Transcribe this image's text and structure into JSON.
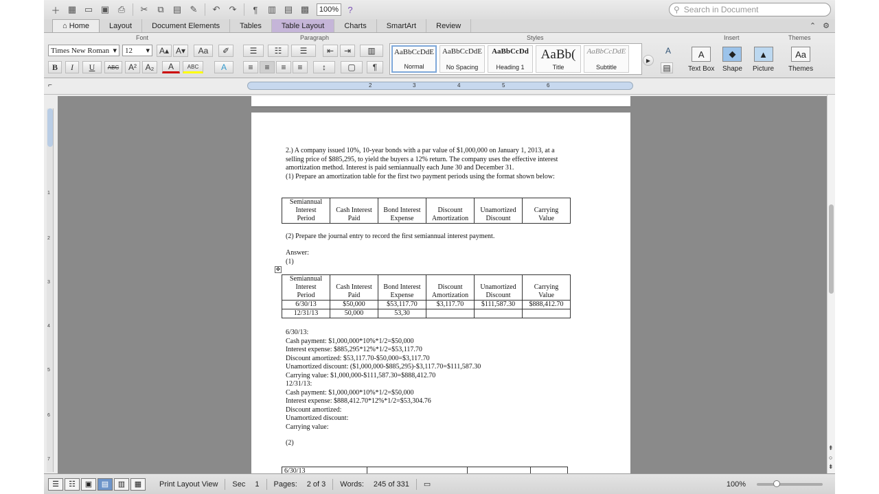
{
  "toolbar": {
    "zoom": "100%",
    "search_placeholder": "Search in Document"
  },
  "tabs": [
    "Home",
    "Layout",
    "Document Elements",
    "Tables",
    "Table Layout",
    "Charts",
    "SmartArt",
    "Review"
  ],
  "ribbon": {
    "font_group": "Font",
    "paragraph_group": "Paragraph",
    "styles_group": "Styles",
    "insert_group": "Insert",
    "themes_group": "Themes",
    "font_name": "Times New Roman",
    "font_size": "12",
    "styles": [
      {
        "sample": "AaBbCcDdE",
        "label": "Normal"
      },
      {
        "sample": "AaBbCcDdE",
        "label": "No Spacing"
      },
      {
        "sample": "AaBbCcDd",
        "label": "Heading 1"
      },
      {
        "sample": "AaBb(",
        "label": "Title"
      },
      {
        "sample": "AaBbCcDdE",
        "label": "Subtitle"
      }
    ],
    "insert": [
      "Text Box",
      "Shape",
      "Picture"
    ],
    "themes": "Themes"
  },
  "ruler": [
    "2",
    "3",
    "4",
    "5",
    "6"
  ],
  "vruler": [
    "1",
    "2",
    "3",
    "4",
    "5",
    "6",
    "7"
  ],
  "document": {
    "intro": [
      "2.) A company issued 10%, 10-year bonds with a par value of $1,000,000 on January 1, 2013, at a",
      "selling price of $885,295, to yield the buyers a 12% return. The company uses the effective interest",
      "amortization method. Interest is paid semiannually each June 30 and December 31.",
      "(1) Prepare an amortization table for the first two payment periods using the format shown below:"
    ],
    "headers": [
      [
        "Semiannual",
        "Interest",
        "Period"
      ],
      [
        "Cash Interest",
        "Paid"
      ],
      [
        "Bond Interest",
        "Expense"
      ],
      [
        "Discount",
        "Amortization"
      ],
      [
        "Unamortized",
        "Discount"
      ],
      [
        "Carrying",
        "Value"
      ]
    ],
    "part2": "(2) Prepare the journal entry to record the first semiannual interest payment.",
    "answer": "Answer:",
    "part1_label": "(1)",
    "rows": [
      [
        "6/30/13",
        "$50,000",
        "$53,117.70",
        "$3,117.70",
        "$111,587.30",
        "$888,412.70"
      ],
      [
        "12/31/13",
        "50,000",
        "53,30",
        "",
        "",
        ""
      ]
    ],
    "calc": [
      "6/30/13:",
      "Cash payment: $1,000,000*10%*1/2=$50,000",
      "Interest expense: $885,295*12%*1/2=$53,117.70",
      "Discount amortized: $53,117.70-$50,000=$3,117.70",
      "Unamortized discount: ($1,000,000-$885,295)-$3,117.70=$111,587.30",
      "Carrying value: $1,000,000-$111,587.30=$888,412.70",
      "12/31/13:",
      "Cash payment: $1,000,000*10%*1/2=$50,000",
      "Interest expense: $888,412.70*12%*1/2=$53,304.76",
      "Discount amortized:",
      "Unamortized discount:",
      "Carrying value:"
    ],
    "part2_label": "(2)",
    "journal_date": "6/30/13"
  },
  "status": {
    "view": "Print Layout View",
    "sec_label": "Sec",
    "sec_value": "1",
    "pages_label": "Pages:",
    "pages_value": "2 of 3",
    "words_label": "Words:",
    "words_value": "245 of 331",
    "zoom": "100%"
  }
}
